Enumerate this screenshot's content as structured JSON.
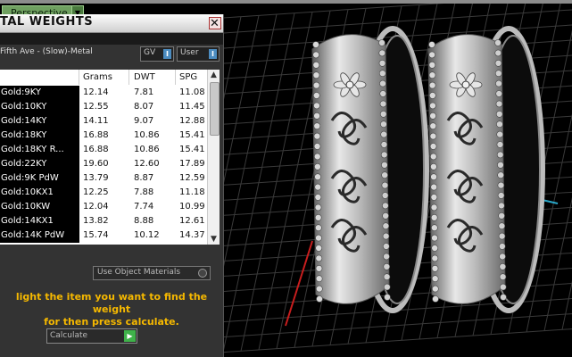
{
  "viewport": {
    "label": "Perspective",
    "dropdown_icon": "chevron-down-icon"
  },
  "panel": {
    "title": "TAL WEIGHTS",
    "close_glyph": "✕",
    "metal_label": "Fifth Ave - (Slow)-Metal",
    "gv_label": "GV",
    "user_label": "User",
    "toggle_glyph": "I",
    "table": {
      "headers": [
        "Grams",
        "DWT",
        "SPG"
      ],
      "rows": [
        [
          "Gold:9KY",
          "12.14",
          "7.81",
          "11.08"
        ],
        [
          "Gold:10KY",
          "12.55",
          "8.07",
          "11.45"
        ],
        [
          "Gold:14KY",
          "14.11",
          "9.07",
          "12.88"
        ],
        [
          "Gold:18KY",
          "16.88",
          "10.86",
          "15.41"
        ],
        [
          "Gold:18KY R...",
          "16.88",
          "10.86",
          "15.41"
        ],
        [
          "Gold:22KY",
          "19.60",
          "12.60",
          "17.89"
        ],
        [
          "Gold:9K PdW",
          "13.79",
          "8.87",
          "12.59"
        ],
        [
          "Gold:10KX1",
          "12.25",
          "7.88",
          "11.18"
        ],
        [
          "Gold:10KW",
          "12.04",
          "7.74",
          "10.99"
        ],
        [
          "Gold:14KX1",
          "13.82",
          "8.88",
          "12.61"
        ],
        [
          "Gold:14K PdW",
          "15.74",
          "10.12",
          "14.37"
        ]
      ]
    },
    "use_object_materials": "Use Object Materials",
    "hint_line1": "light the item you want to find the weight",
    "hint_line2": "for then press calculate.",
    "calculate_label": "Calculate",
    "colors": {
      "hint": "#f5b800",
      "accent_green": "#3fb24a",
      "toggle_blue": "#4c8cc0"
    }
  }
}
